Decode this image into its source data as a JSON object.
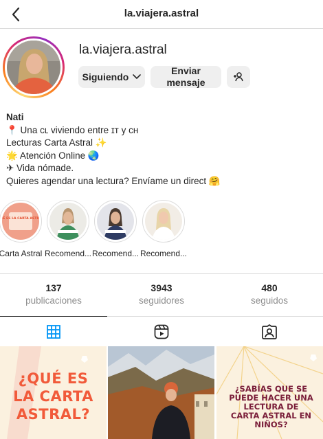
{
  "header": {
    "title": "la.viajera.astral"
  },
  "profile": {
    "username": "la.viajera.astral",
    "buttons": {
      "following": "Siguiendo",
      "message": "Enviar mensaje"
    }
  },
  "bio": {
    "name": "Nati",
    "lines": [
      "📍 Una ᴄʟ viviendo entre ɪᴛ y ᴄʜ",
      "Lecturas Carta Astral ✨",
      "🌟  Atención Online 🌏",
      "✈ Vida nómade.",
      "Quieres agendar una lectura? Envíame un direct 🤗"
    ]
  },
  "highlights": [
    {
      "label": "Carta Astral",
      "thumb_text": "¿QUÉ ES LA CARTA ASTRAL?"
    },
    {
      "label": "Recomend..."
    },
    {
      "label": "Recomend..."
    },
    {
      "label": "Recomend..."
    }
  ],
  "stats": [
    {
      "value": "137",
      "label": "publicaciones"
    },
    {
      "value": "3943",
      "label": "seguidores"
    },
    {
      "value": "480",
      "label": "seguidos"
    }
  ],
  "posts": [
    {
      "caption": "¿QUÉ ES LA CARTA ASTRAL?"
    },
    {
      "caption": ""
    },
    {
      "caption": "¿SABÍAS QUE SE PUEDE HACER UNA LECTURA DE CARTA ASTRAL EN NIÑOS?"
    }
  ],
  "colors": {
    "text": "#262626",
    "muted": "#8e8e8e",
    "accent": "#0095f6",
    "button_bg": "#efefef",
    "post_cream": "#fbf1df",
    "post_orange": "#f15a3a",
    "post_burgundy": "#7a1e3a"
  },
  "icons": {
    "back": "chevron-left-icon",
    "dropdown": "chevron-down-icon",
    "suggest": "add-person-icon",
    "tab_grid": "grid-icon",
    "tab_reels": "reels-icon",
    "tab_tagged": "tagged-icon"
  }
}
